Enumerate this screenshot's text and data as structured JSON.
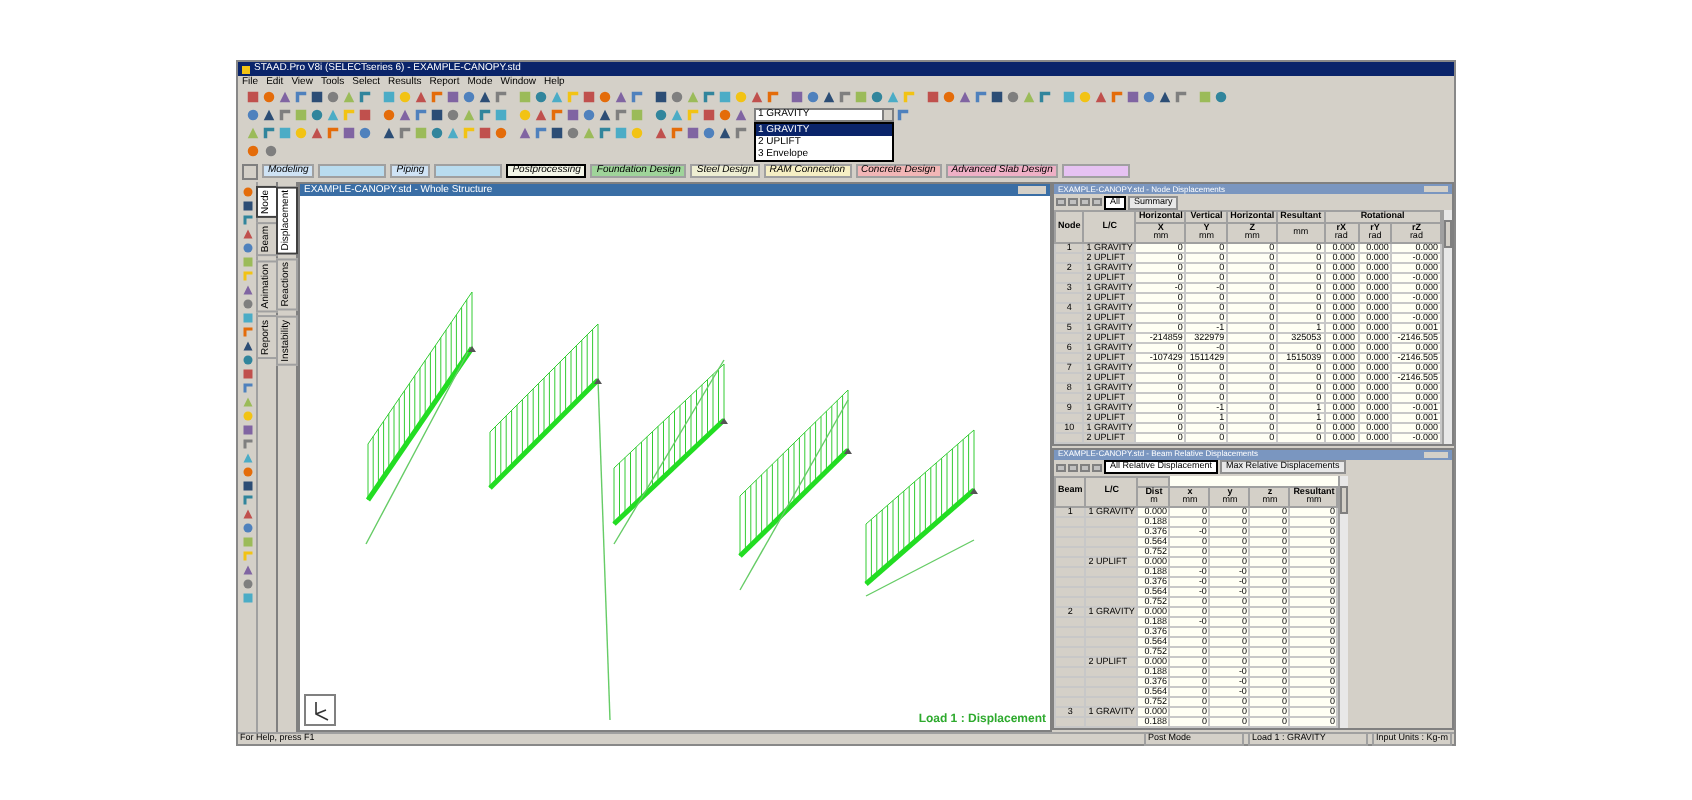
{
  "window": {
    "title": "STAAD.Pro V8i (SELECTseries 6) - EXAMPLE-CANOPY.std"
  },
  "menu": [
    "File",
    "Edit",
    "View",
    "Tools",
    "Select",
    "Results",
    "Report",
    "Mode",
    "Window",
    "Help"
  ],
  "load_case_dropdown": {
    "value": "1 GRAVITY",
    "options": [
      {
        "label": "1 GRAVITY",
        "selected": true
      },
      {
        "label": "2 UPLIFT",
        "selected": false
      },
      {
        "label": "3 Envelope",
        "selected": false
      }
    ]
  },
  "workflow_tabs": [
    {
      "label": "Modeling",
      "color": "#cfe3f5",
      "selected": false
    },
    {
      "color": "#b9dcef",
      "selected": false
    },
    {
      "label": "Piping",
      "color": "#cfe3f5",
      "selected": false
    },
    {
      "color": "#b9dcef",
      "selected": false
    },
    {
      "label": "Postprocessing",
      "color": "#f4f6e8",
      "selected": true
    },
    {
      "label": "Foundation Design",
      "color": "#9fd49a",
      "selected": false
    },
    {
      "label": "Steel Design",
      "color": "#eeeed2",
      "selected": false
    },
    {
      "label": "RAM Connection",
      "color": "#f6efc4",
      "selected": false
    },
    {
      "label": "Concrete Design",
      "color": "#f2b6b6",
      "selected": false
    },
    {
      "label": "Advanced Slab Design",
      "color": "#efb0c6",
      "selected": false
    },
    {
      "color": "#e6c2f2",
      "selected": false
    }
  ],
  "side_tabs": [
    {
      "label": "Node",
      "selected": true
    },
    {
      "label": "Beam",
      "selected": false
    },
    {
      "label": "Animation",
      "selected": false
    },
    {
      "label": "Reports",
      "selected": false
    }
  ],
  "sub_tabs": [
    {
      "label": "Displacement",
      "selected": true
    },
    {
      "label": "Reactions",
      "selected": false
    },
    {
      "label": "Instability",
      "selected": false
    }
  ],
  "view": {
    "title": "EXAMPLE-CANOPY.std - Whole Structure",
    "load_label": "Load 1 : Displacement"
  },
  "node_table": {
    "title": "EXAMPLE-CANOPY.std - Node Displacements",
    "tabs": [
      {
        "label": "All",
        "selected": true
      },
      {
        "label": "Summary",
        "selected": false
      }
    ],
    "columns": [
      {
        "name": "Node"
      },
      {
        "name": "L/C"
      },
      {
        "group": "Horizontal",
        "name": "X",
        "unit": "mm"
      },
      {
        "group": "Vertical",
        "name": "Y",
        "unit": "mm"
      },
      {
        "group": "Horizontal",
        "name": "Z",
        "unit": "mm"
      },
      {
        "group": "Resultant",
        "unit": "mm"
      },
      {
        "group": "Rotational",
        "name": "rX",
        "unit": "rad"
      },
      {
        "name": "rY",
        "unit": "rad"
      },
      {
        "name": "rZ",
        "unit": "rad"
      }
    ],
    "rows": [
      {
        "node": "1",
        "lc": "1 GRAVITY",
        "values": [
          "0",
          "0",
          "0",
          "0",
          "0.000",
          "0.000",
          "0.000"
        ]
      },
      {
        "lc": "2 UPLIFT",
        "values": [
          "0",
          "0",
          "0",
          "0",
          "0.000",
          "0.000",
          "-0.000"
        ]
      },
      {
        "node": "2",
        "lc": "1 GRAVITY",
        "values": [
          "0",
          "0",
          "0",
          "0",
          "0.000",
          "0.000",
          "0.000"
        ]
      },
      {
        "lc": "2 UPLIFT",
        "values": [
          "0",
          "0",
          "0",
          "0",
          "0.000",
          "0.000",
          "-0.000"
        ]
      },
      {
        "node": "3",
        "lc": "1 GRAVITY",
        "values": [
          "-0",
          "-0",
          "0",
          "0",
          "0.000",
          "0.000",
          "0.000"
        ]
      },
      {
        "lc": "2 UPLIFT",
        "values": [
          "0",
          "0",
          "0",
          "0",
          "0.000",
          "0.000",
          "-0.000"
        ]
      },
      {
        "node": "4",
        "lc": "1 GRAVITY",
        "values": [
          "0",
          "0",
          "0",
          "0",
          "0.000",
          "0.000",
          "0.000"
        ]
      },
      {
        "lc": "2 UPLIFT",
        "values": [
          "0",
          "0",
          "0",
          "0",
          "0.000",
          "0.000",
          "-0.000"
        ]
      },
      {
        "node": "5",
        "lc": "1 GRAVITY",
        "values": [
          "0",
          "-1",
          "0",
          "1",
          "0.000",
          "0.000",
          "0.001"
        ]
      },
      {
        "lc": "2 UPLIFT",
        "values": [
          "-214859",
          "322979",
          "0",
          "325053",
          "0.000",
          "0.000",
          "-2146.505"
        ]
      },
      {
        "node": "6",
        "lc": "1 GRAVITY",
        "values": [
          "0",
          "-0",
          "0",
          "0",
          "0.000",
          "0.000",
          "0.000"
        ]
      },
      {
        "lc": "2 UPLIFT",
        "values": [
          "-107429",
          "1511429",
          "0",
          "1515039",
          "0.000",
          "0.000",
          "-2146.505"
        ]
      },
      {
        "node": "7",
        "lc": "1 GRAVITY",
        "values": [
          "0",
          "0",
          "0",
          "0",
          "0.000",
          "0.000",
          "0.000"
        ]
      },
      {
        "lc": "2 UPLIFT",
        "values": [
          "0",
          "0",
          "0",
          "0",
          "0.000",
          "0.000",
          "-2146.505"
        ]
      },
      {
        "node": "8",
        "lc": "1 GRAVITY",
        "values": [
          "0",
          "0",
          "0",
          "0",
          "0.000",
          "0.000",
          "0.000"
        ]
      },
      {
        "lc": "2 UPLIFT",
        "values": [
          "0",
          "0",
          "0",
          "0",
          "0.000",
          "0.000",
          "0.000"
        ]
      },
      {
        "node": "9",
        "lc": "1 GRAVITY",
        "values": [
          "0",
          "-1",
          "0",
          "1",
          "0.000",
          "0.000",
          "-0.001"
        ]
      },
      {
        "lc": "2 UPLIFT",
        "values": [
          "0",
          "1",
          "0",
          "1",
          "0.000",
          "0.000",
          "0.001"
        ]
      },
      {
        "node": "10",
        "lc": "1 GRAVITY",
        "values": [
          "0",
          "0",
          "0",
          "0",
          "0.000",
          "0.000",
          "0.000"
        ]
      },
      {
        "lc": "2 UPLIFT",
        "values": [
          "0",
          "0",
          "0",
          "0",
          "0.000",
          "0.000",
          "-0.000"
        ]
      }
    ]
  },
  "beam_table": {
    "title": "EXAMPLE-CANOPY.std - Beam Relative Displacements",
    "tabs": [
      {
        "label": "All Relative Displacement",
        "selected": true
      },
      {
        "label": "Max Relative Displacements",
        "selected": false
      }
    ],
    "columns": [
      {
        "name": "Beam"
      },
      {
        "name": "L/C"
      },
      {
        "name": "Dist",
        "unit": "m"
      },
      {
        "name": "x",
        "unit": "mm"
      },
      {
        "name": "y",
        "unit": "mm"
      },
      {
        "name": "z",
        "unit": "mm"
      },
      {
        "name": "Resultant",
        "unit": "mm"
      }
    ],
    "rows": [
      {
        "beam": "1",
        "lc": "1 GRAVITY",
        "dist": "0.000",
        "values": [
          "0",
          "0",
          "0",
          "0"
        ]
      },
      {
        "dist": "0.188",
        "values": [
          "0",
          "0",
          "0",
          "0"
        ]
      },
      {
        "dist": "0.376",
        "values": [
          "-0",
          "0",
          "0",
          "0"
        ]
      },
      {
        "dist": "0.564",
        "values": [
          "0",
          "0",
          "0",
          "0"
        ]
      },
      {
        "dist": "0.752",
        "values": [
          "0",
          "0",
          "0",
          "0"
        ]
      },
      {
        "lc": "2 UPLIFT",
        "dist": "0.000",
        "values": [
          "0",
          "0",
          "0",
          "0"
        ]
      },
      {
        "dist": "0.188",
        "values": [
          "-0",
          "-0",
          "0",
          "0"
        ]
      },
      {
        "dist": "0.376",
        "values": [
          "-0",
          "-0",
          "0",
          "0"
        ]
      },
      {
        "dist": "0.564",
        "values": [
          "-0",
          "-0",
          "0",
          "0"
        ]
      },
      {
        "dist": "0.752",
        "values": [
          "0",
          "0",
          "0",
          "0"
        ]
      },
      {
        "beam": "2",
        "lc": "1 GRAVITY",
        "dist": "0.000",
        "values": [
          "0",
          "0",
          "0",
          "0"
        ]
      },
      {
        "dist": "0.188",
        "values": [
          "-0",
          "0",
          "0",
          "0"
        ]
      },
      {
        "dist": "0.376",
        "values": [
          "0",
          "0",
          "0",
          "0"
        ]
      },
      {
        "dist": "0.564",
        "values": [
          "0",
          "0",
          "0",
          "0"
        ]
      },
      {
        "dist": "0.752",
        "values": [
          "0",
          "0",
          "0",
          "0"
        ]
      },
      {
        "lc": "2 UPLIFT",
        "dist": "0.000",
        "values": [
          "0",
          "0",
          "0",
          "0"
        ]
      },
      {
        "dist": "0.188",
        "values": [
          "0",
          "-0",
          "0",
          "0"
        ]
      },
      {
        "dist": "0.376",
        "values": [
          "0",
          "-0",
          "0",
          "0"
        ]
      },
      {
        "dist": "0.564",
        "values": [
          "0",
          "-0",
          "0",
          "0"
        ]
      },
      {
        "dist": "0.752",
        "values": [
          "0",
          "0",
          "0",
          "0"
        ]
      },
      {
        "beam": "3",
        "lc": "1 GRAVITY",
        "dist": "0.000",
        "values": [
          "0",
          "0",
          "0",
          "0"
        ]
      },
      {
        "dist": "0.188",
        "values": [
          "0",
          "0",
          "0",
          "0"
        ]
      }
    ]
  },
  "status_bar": {
    "help": "For Help, press F1",
    "mode": "Post Mode",
    "load": "Load 1 : GRAVITY",
    "units": "Input Units : Kg-m"
  }
}
